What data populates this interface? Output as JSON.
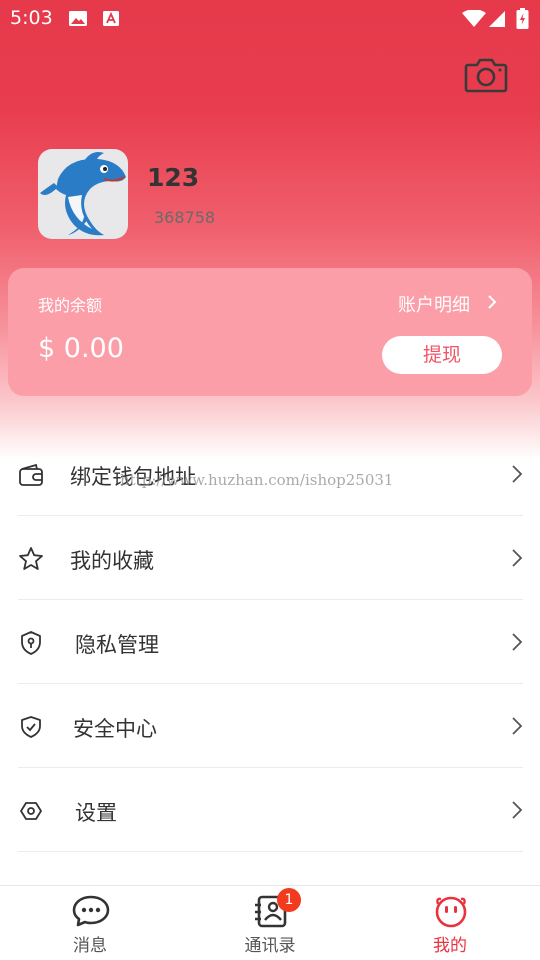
{
  "status_bar": {
    "time": "5:03"
  },
  "profile": {
    "username": "123",
    "user_id": "368758"
  },
  "balance_card": {
    "label": "我的余额",
    "detail_link": "账户明细",
    "amount": "$ 0.00",
    "withdraw_button": "提现"
  },
  "menu": [
    {
      "label": "绑定钱包地址",
      "icon": "wallet-icon"
    },
    {
      "label": "我的收藏",
      "icon": "star-icon"
    },
    {
      "label": "隐私管理",
      "icon": "privacy-shield-icon"
    },
    {
      "label": "安全中心",
      "icon": "security-shield-icon"
    },
    {
      "label": "设置",
      "icon": "settings-icon"
    }
  ],
  "watermark": "http://www.huzhan.com/ishop25031",
  "tab_bar": {
    "tabs": [
      {
        "label": "消息",
        "icon": "chat-bubble-icon",
        "active": false
      },
      {
        "label": "通讯录",
        "icon": "contacts-icon",
        "active": false,
        "badge": "1"
      },
      {
        "label": "我的",
        "icon": "face-icon",
        "active": true
      }
    ]
  },
  "colors": {
    "accent": "#e8333e",
    "card_bg": "#fb9ea7",
    "header_top": "#e63a4b",
    "badge": "#f23a1e"
  }
}
